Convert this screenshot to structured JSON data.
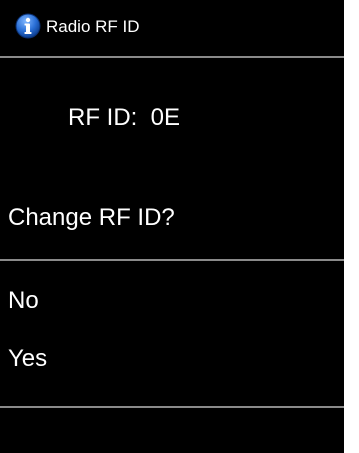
{
  "header": {
    "title": "Radio RF ID",
    "icon": "info-icon",
    "icon_color": "#2a6fd6"
  },
  "rfid": {
    "label": "RF ID:",
    "value": "0E"
  },
  "prompt": {
    "question": "Change RF ID?"
  },
  "options": [
    {
      "label": "No"
    },
    {
      "label": "Yes"
    }
  ],
  "colors": {
    "background": "#000000",
    "text": "#ffffff",
    "divider": "#8a8a8a"
  }
}
